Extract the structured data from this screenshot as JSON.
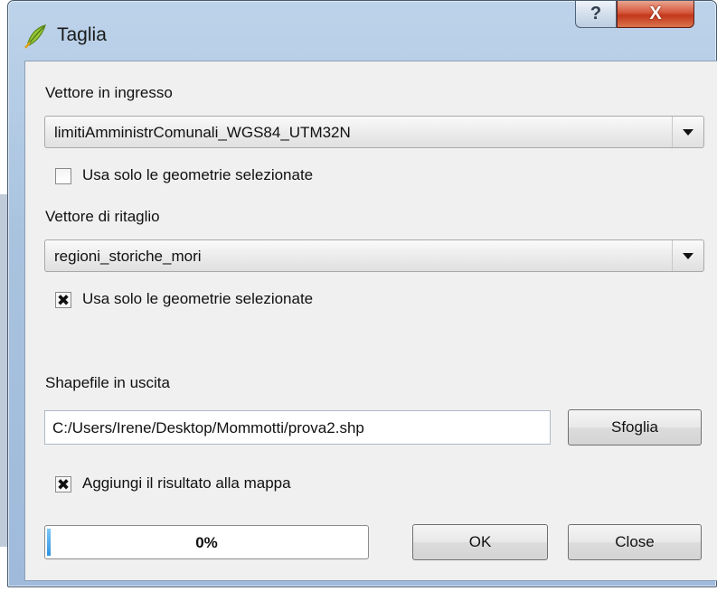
{
  "window": {
    "title": "Taglia",
    "help_glyph": "?",
    "close_glyph": "X",
    "icon": "qgis-leaf-icon"
  },
  "input_layer": {
    "label": "Vettore in ingresso",
    "selected": "limitiAmministrComunali_WGS84_UTM32N",
    "selected_only_label": "Usa solo le geometrie selezionate",
    "selected_only_checked": false
  },
  "clip_layer": {
    "label": "Vettore di ritaglio",
    "selected": "regioni_storiche_mori",
    "selected_only_label": "Usa solo le geometrie selezionate",
    "selected_only_checked": true
  },
  "output": {
    "label": "Shapefile in uscita",
    "path": "C:/Users/Irene/Desktop/Mommotti/prova2.shp",
    "browse_label": "Sfoglia",
    "add_to_map_label": "Aggiungi il risultato alla mappa",
    "add_to_map_checked": true
  },
  "footer": {
    "progress_text": "0%",
    "progress_value": 0,
    "ok_label": "OK",
    "close_label": "Close"
  },
  "check_glyph": "✖"
}
